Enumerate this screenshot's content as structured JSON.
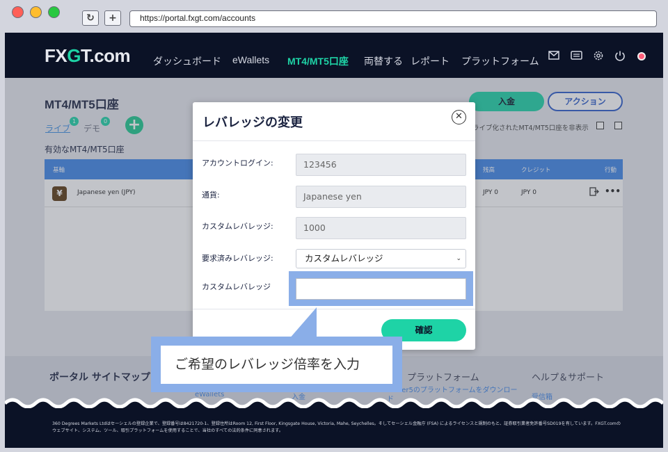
{
  "browser": {
    "url": "https://portal.fxgt.com/accounts",
    "reload_icon": "↻",
    "plus_icon": "+"
  },
  "nav": {
    "logo_fx": "FX",
    "logo_g": "G",
    "logo_rest": "T.com",
    "links": [
      "ダッシュボード",
      "eWallets",
      "MT4/MT5口座",
      "両替する",
      "レポート",
      "プラットフォーム"
    ],
    "active_index": 2,
    "icons": [
      "mail-icon",
      "ticket-icon",
      "gear-icon",
      "power-icon",
      "record-icon"
    ]
  },
  "page": {
    "title": "MT4/MT5口座",
    "tab_live": "ライブ",
    "tab_live_count": "1",
    "tab_demo": "デモ",
    "tab_demo_count": "0",
    "add_icon": "+",
    "section_label": "有効なMT4/MT5口座",
    "deposit_label": "入金",
    "action_label": "アクション",
    "hide_label": "ライブ化されたMT4/MT5口座を非表示",
    "table": {
      "headers": [
        "基軸",
        "残高",
        "クレジット",
        "行動"
      ],
      "row": {
        "currency_icon": "¥",
        "currency_name": "Japanese yen (JPY)",
        "balance": "JPY 0",
        "credit": "JPY 0",
        "more_icon": "•••"
      }
    }
  },
  "footer": {
    "title": "ポータル サイトマップ",
    "col_platform": "プラットフォーム",
    "col_help": "ヘルプ＆サポート",
    "link_ewallets": "eWallets",
    "link_deposit": "入金",
    "link_download": "Trader5のプラットフォームをダウンロード",
    "link_inbox": "受信箱",
    "legal": "360 Degrees Markets Ltdはセーシェルの登録企業で、登録番号は8421720-1、登録住所はRoom 12, First Floor, Kingsgate House, Victoria, Mahe, Seychelles。そしてセーシェル金融庁 (FSA) によるライセンスと規制のもと、証券取引業者免許番号SD019を有しています。FXGT.comのウェブサイト、システム、ツール、取引プラットフォームを使用することで、当社のすべての法的条件に同意されます。"
  },
  "modal": {
    "title": "レバレッジの変更",
    "close_icon": "✕",
    "fields": [
      {
        "label": "アカウントログイン:",
        "value": "123456"
      },
      {
        "label": "通貨:",
        "value": "Japanese yen"
      },
      {
        "label": "カスタムレバレッジ:",
        "value": "1000"
      }
    ],
    "requested_label": "要求済みレバレッジ:",
    "requested_value": "カスタムレバレッジ",
    "chevron_icon": "⌄",
    "custom_label": "カスタムレバレッジ",
    "custom_value": "",
    "confirm_label": "確認"
  },
  "callout": {
    "text": "ご希望のレバレッジ倍率を入力"
  },
  "colors": {
    "accent": "#1ed3a6",
    "nav_bg": "#0b1226",
    "highlight": "#8aaee8",
    "table_header": "#3f86e6"
  }
}
